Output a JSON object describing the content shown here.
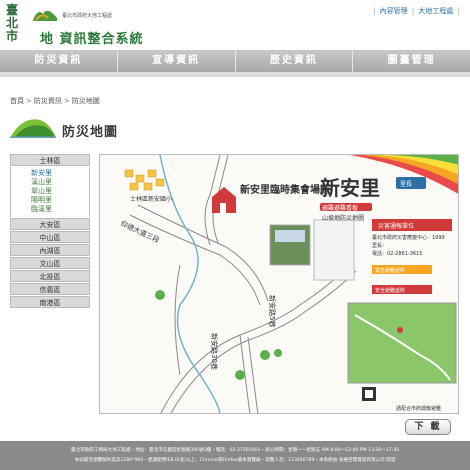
{
  "header": {
    "city": "臺北市",
    "org": "臺北市政府大地工程處",
    "site_title": "地 資訊整合系統",
    "top_links": [
      "內容管理",
      "大地工程處"
    ]
  },
  "nav": {
    "items": [
      "防災資訊",
      "宣導資訊",
      "歷史資訊",
      "圖臺管理"
    ]
  },
  "breadcrumb": [
    "首頁",
    "防災資訊",
    "防災地圖"
  ],
  "page": {
    "title": "防災地圖"
  },
  "sidebar": {
    "groups": [
      {
        "label": "士林區",
        "open": true,
        "sub": [
          "新安里",
          "溪山里",
          "翠山里",
          "陽明里",
          "臨溪里"
        ]
      },
      {
        "label": "大安區"
      },
      {
        "label": "中山區"
      },
      {
        "label": "內湖區"
      },
      {
        "label": "文山區"
      },
      {
        "label": "北投區"
      },
      {
        "label": "信義區"
      },
      {
        "label": "南港區"
      }
    ]
  },
  "map": {
    "title_big": "新安里",
    "title_sub": "避難避難看板",
    "title_sub2": "山坡地防災地圖",
    "temp_site": "新安里臨時集會場所",
    "road1": "仰德大道三段",
    "road2": "新安路5巷",
    "road3": "新安路30巷",
    "landmark": "士林區新安國小",
    "badge": "里長",
    "contact_title": "災害通報單位",
    "contact_lines": [
      "臺北市政府災害應變中心：1999",
      "里長：",
      "電話：02-2861-3615"
    ],
    "section2": "緊急避難處所",
    "section3": "安全避難處所",
    "qr_note": "請配合市府疏散避難"
  },
  "download": {
    "label": "下 載"
  },
  "footer": {
    "line1": "臺北市政府工務局大地工程處・地址：臺北市信義區松德路300號3樓・電話：02-27593001・辦公時間：星期一～星期五 AM 8:00～12:00 PM 13:30～17:30",
    "line2": "本站最佳瀏覽解析度為1280*960・建議使用IE8.0(含)以上、Chrome或Firefox版本瀏覽器・瀏覽人次：123456789・本系統由 多維空間資訊有限公司 開發"
  },
  "colors": {
    "accent_green": "#2c7a3c",
    "nav_gray": "#b5b5b5",
    "link_blue": "#2c6ea5",
    "map_red": "#d13a3a",
    "footer_gray": "#8a8a8a"
  }
}
